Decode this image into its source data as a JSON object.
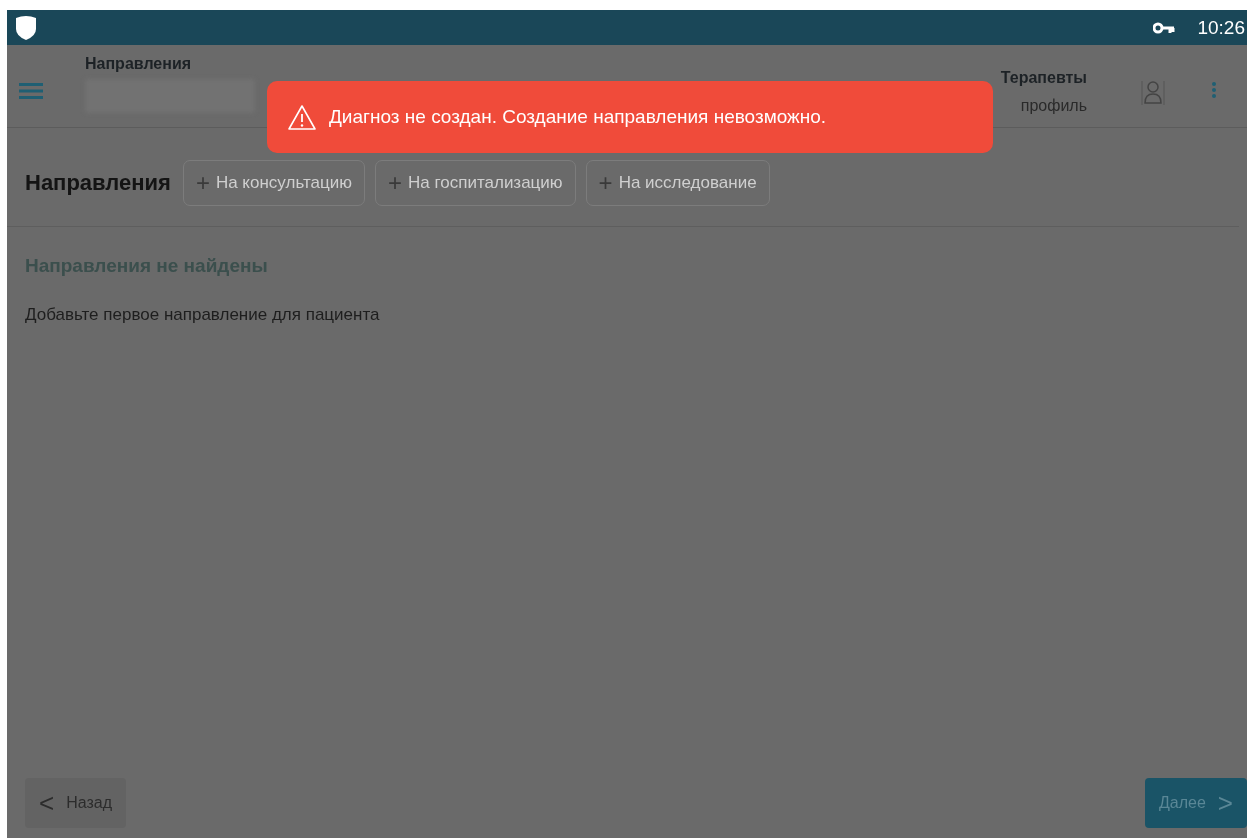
{
  "status_bar": {
    "time": "10:26"
  },
  "header": {
    "title": "Направления",
    "role": "Терапевты",
    "role_link": "профиль"
  },
  "toast": {
    "message": "Диагноз не создан. Создание направления невозможно."
  },
  "section": {
    "title": "Направления",
    "actions": [
      {
        "icon": "+",
        "label": "На консультацию",
        "disabled": true
      },
      {
        "icon": "+",
        "label": "На госпитализацию",
        "disabled": true
      },
      {
        "icon": "+",
        "label": "На исследование",
        "disabled": true
      }
    ]
  },
  "empty_state": {
    "title": "Направления не найдены",
    "text": "Добавьте первое направление для пациента"
  },
  "footer": {
    "back": {
      "icon": "<",
      "label": "Назад",
      "disabled": false
    },
    "next": {
      "label": "Далее",
      "icon": ">",
      "disabled": true
    }
  }
}
